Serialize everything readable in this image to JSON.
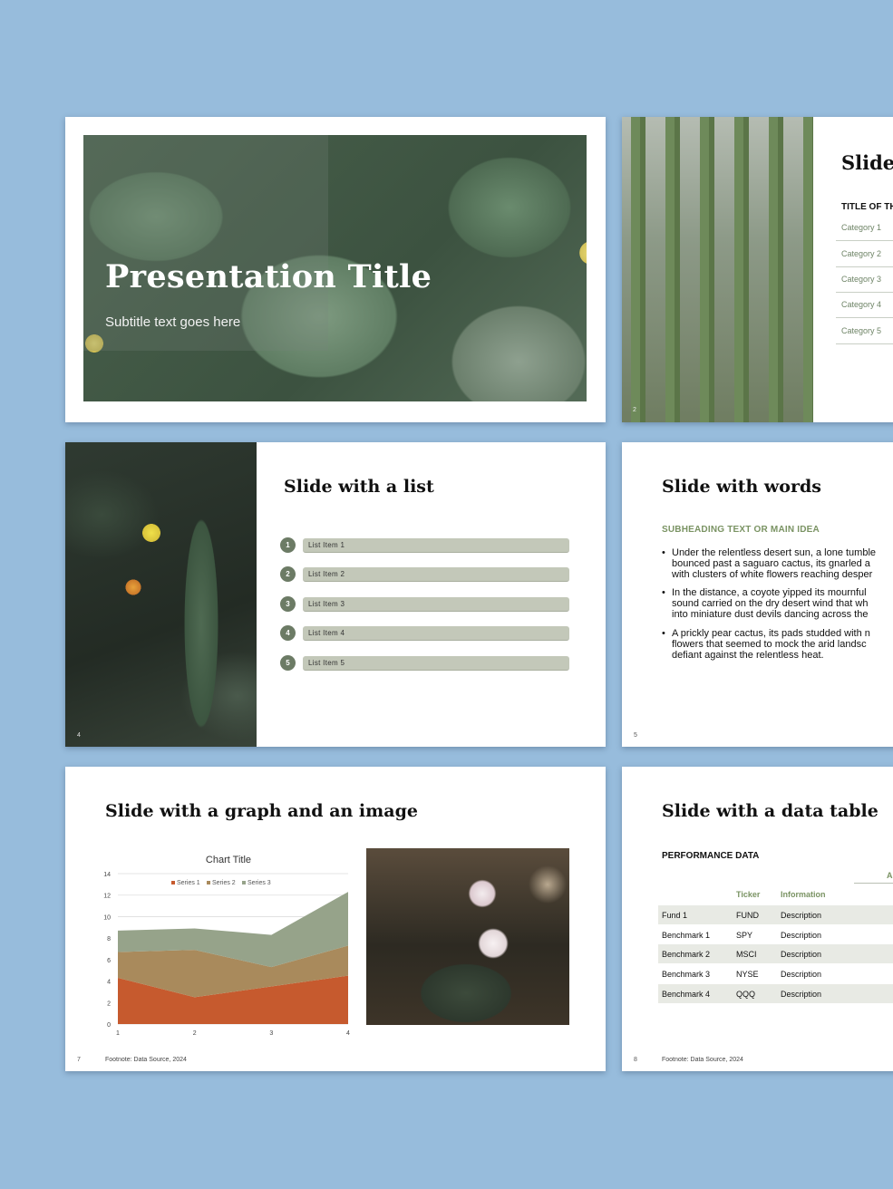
{
  "slide1": {
    "title": "Presentation Title",
    "subtitle": "Subtitle text goes here"
  },
  "slide2": {
    "heading": "Slide w",
    "subheading": "TITLE OF TH",
    "number": "2",
    "categories": [
      "Category 1",
      "Category 2",
      "Category 3",
      "Category 4",
      "Category 5"
    ]
  },
  "slide3": {
    "heading": "Slide with a list",
    "number": "4",
    "items": [
      {
        "num": "1",
        "label": "List Item 1"
      },
      {
        "num": "2",
        "label": "List Item 2"
      },
      {
        "num": "3",
        "label": "List Item 3"
      },
      {
        "num": "4",
        "label": "List Item 4"
      },
      {
        "num": "5",
        "label": "List Item 5"
      }
    ]
  },
  "slide4": {
    "heading": "Slide with words",
    "subheading": "SUBHEADING TEXT OR MAIN IDEA",
    "number": "5",
    "bullets": [
      "Under the relentless desert sun, a lone tumble\nbounced past a saguaro cactus, its gnarled a\nwith clusters of white flowers reaching desper",
      "In the distance, a coyote yipped its mournful\nsound carried on the dry desert wind that wh\ninto miniature dust devils dancing across the",
      "A prickly pear cactus, its pads studded with n\nflowers that seemed to mock the arid landsc\ndefiant against the relentless heat."
    ]
  },
  "slide5": {
    "heading": "Slide with a graph and an image",
    "number": "7",
    "footnote": "Footnote: Data Source, 2024"
  },
  "slide6": {
    "heading": "Slide with a data table",
    "subheading": "PERFORMANCE DATA",
    "number": "8",
    "footnote": "Footnote: Data Source, 2024",
    "group_header": "A",
    "columns": [
      "Ticker",
      "Information"
    ],
    "rows": [
      {
        "name": "Fund 1",
        "ticker": "FUND",
        "info": "Description"
      },
      {
        "name": "Benchmark 1",
        "ticker": "SPY",
        "info": "Description"
      },
      {
        "name": "Benchmark 2",
        "ticker": "MSCI",
        "info": "Description"
      },
      {
        "name": "Benchmark 3",
        "ticker": "NYSE",
        "info": "Description"
      },
      {
        "name": "Benchmark 4",
        "ticker": "QQQ",
        "info": "Description"
      }
    ]
  },
  "chart_data": {
    "type": "area",
    "stacked": true,
    "title": "Chart Title",
    "x": [
      1,
      2,
      3,
      4
    ],
    "ylim": [
      0,
      14
    ],
    "yticks": [
      0,
      2,
      4,
      6,
      8,
      10,
      12,
      14
    ],
    "grid": true,
    "legend": "top",
    "series": [
      {
        "name": "Series 1",
        "values": [
          4.3,
          2.5,
          3.5,
          4.5
        ],
        "color": "#c65a2e"
      },
      {
        "name": "Series 2",
        "values": [
          2.4,
          4.4,
          1.8,
          2.8
        ],
        "color": "#a98a5c"
      },
      {
        "name": "Series 3",
        "values": [
          2.0,
          2.0,
          3.0,
          5.0
        ],
        "color": "#96a38a"
      }
    ]
  }
}
